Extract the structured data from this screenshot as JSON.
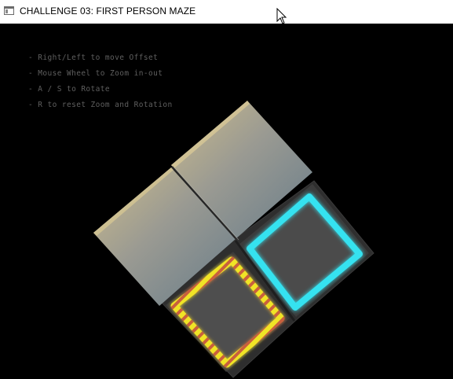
{
  "window": {
    "title": "CHALLENGE 03: FIRST PERSON MAZE",
    "icon": "app-window-icon",
    "cursor": "mouse-pointer-icon"
  },
  "instructions": [
    "- Right/Left to move Offset",
    "- Mouse Wheel to Zoom in-out",
    "- A / S to Rotate",
    "- R to reset Zoom and Rotation"
  ],
  "scene": {
    "background": "#000000",
    "wall_color_top": "#c2b48a",
    "wall_color_mid": "#8a8a8a",
    "wall_color_bottom": "#4fb3c4",
    "floor_color": "#5a5a5a",
    "goal_color": "#38e4f2",
    "hazard_colors": [
      "#f0e428",
      "#c4563e"
    ]
  }
}
